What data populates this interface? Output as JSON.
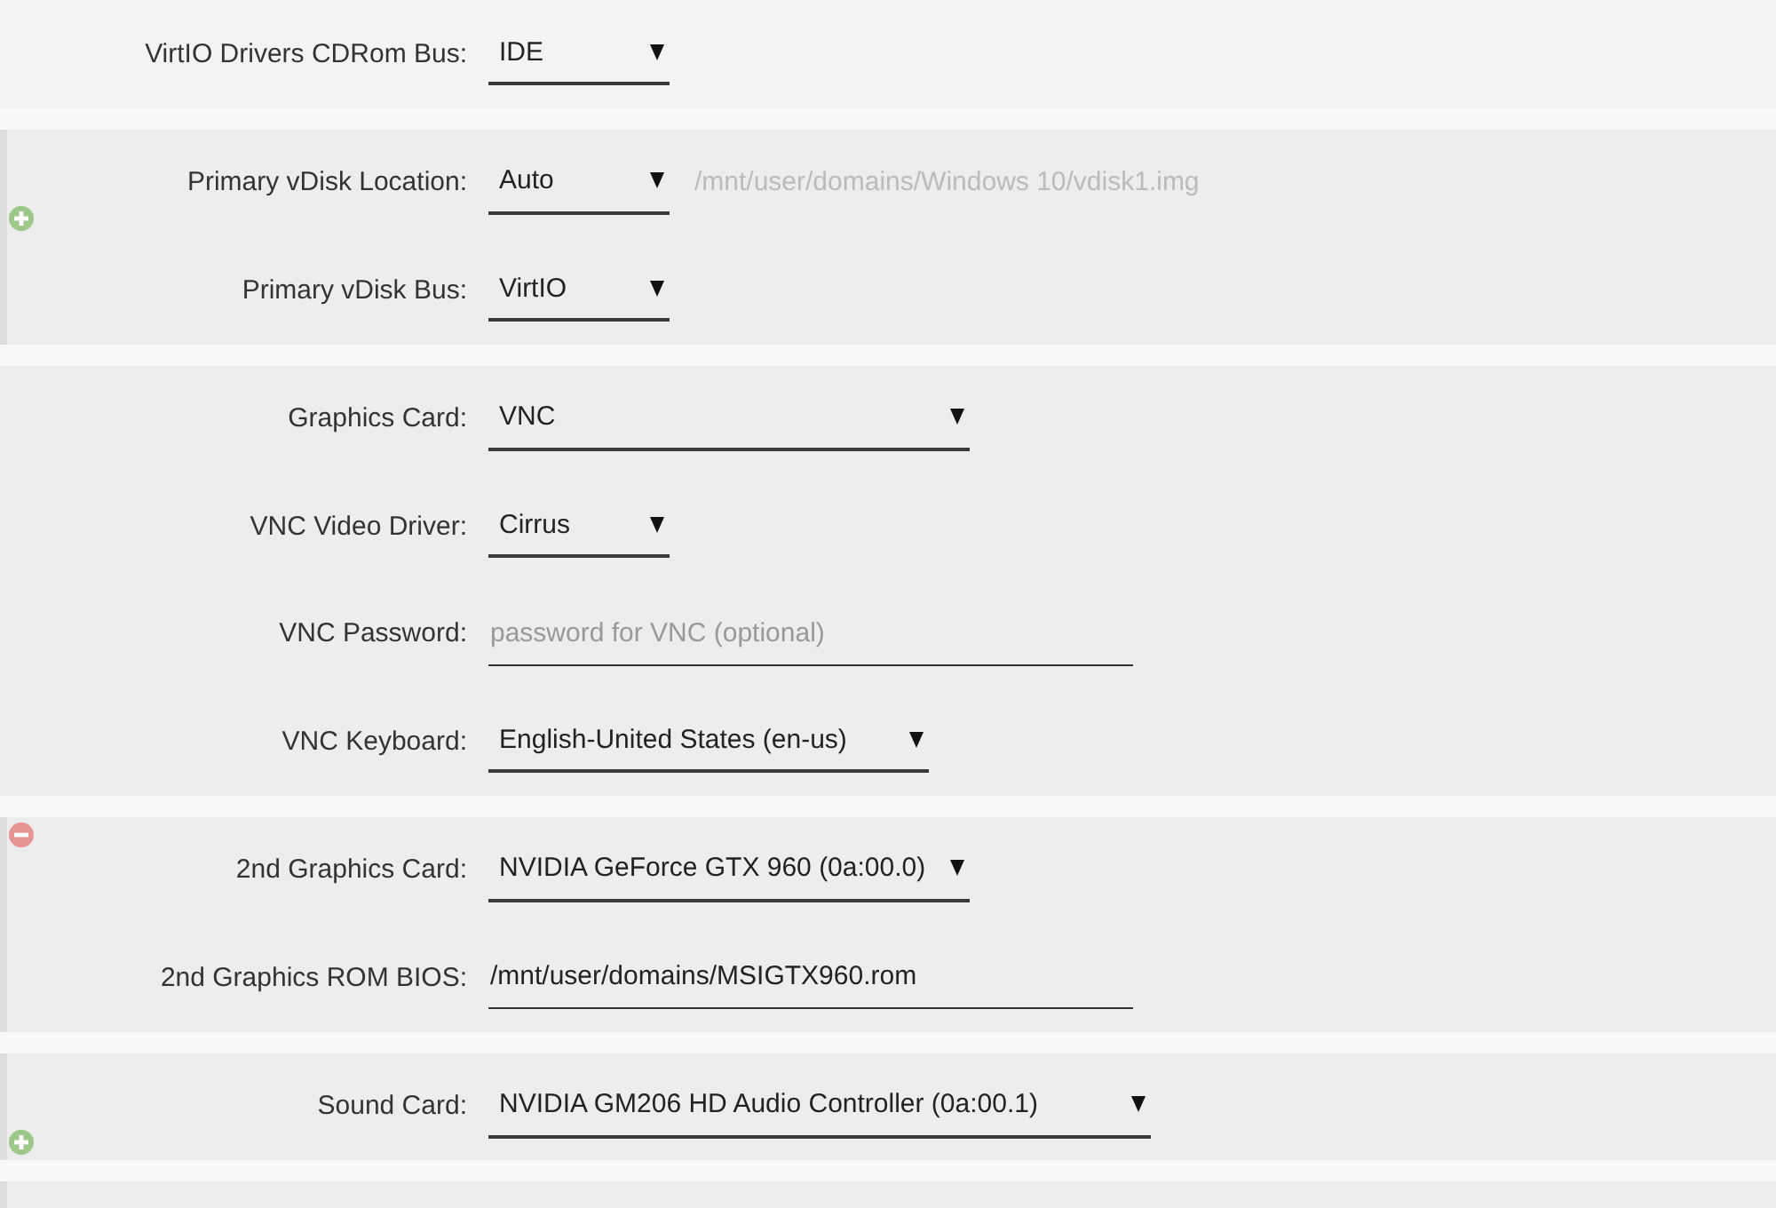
{
  "sections": [
    {
      "kind": "plain",
      "add": false,
      "remove": false,
      "rows": [
        {
          "label": "VirtIO Drivers CDRom Bus:",
          "control": {
            "kind": "select",
            "value": "IDE"
          }
        }
      ]
    },
    {
      "kind": "multi",
      "add": true,
      "remove": false,
      "rows": [
        {
          "label": "Primary vDisk Location:",
          "control": {
            "kind": "select",
            "value": "Auto"
          },
          "path": {
            "value": "/mnt/user/domains/Windows 10/vdisk1.img",
            "disabled": true
          }
        },
        {
          "label": "Primary vDisk Bus:",
          "control": {
            "kind": "select",
            "value": "VirtIO"
          }
        }
      ]
    },
    {
      "kind": "group",
      "add": false,
      "remove": false,
      "rows": [
        {
          "label": "Graphics Card:",
          "control": {
            "kind": "select",
            "value": "VNC"
          }
        },
        {
          "label": "VNC Video Driver:",
          "control": {
            "kind": "select",
            "value": "Cirrus"
          }
        },
        {
          "label": "VNC Password:",
          "control": {
            "kind": "password",
            "placeholder": "password for VNC (optional)"
          }
        },
        {
          "label": "VNC Keyboard:",
          "control": {
            "kind": "select",
            "value": "English-United States (en-us)"
          }
        }
      ]
    },
    {
      "kind": "multi",
      "add": false,
      "remove": true,
      "rows": [
        {
          "label": "2nd Graphics Card:",
          "control": {
            "kind": "select",
            "value": "NVIDIA GeForce GTX 960 (0a:00.0)"
          }
        },
        {
          "label": "2nd Graphics ROM BIOS:",
          "control": {
            "kind": "text",
            "value": "/mnt/user/domains/MSIGTX960.rom"
          }
        }
      ]
    },
    {
      "kind": "multi",
      "add": true,
      "remove": false,
      "rows": [
        {
          "label": "Sound Card:",
          "control": {
            "kind": "select",
            "value": "NVIDIA GM206 HD Audio Controller (0a:00.1)"
          }
        }
      ]
    },
    {
      "kind": "multi",
      "add": false,
      "remove": false
    }
  ]
}
